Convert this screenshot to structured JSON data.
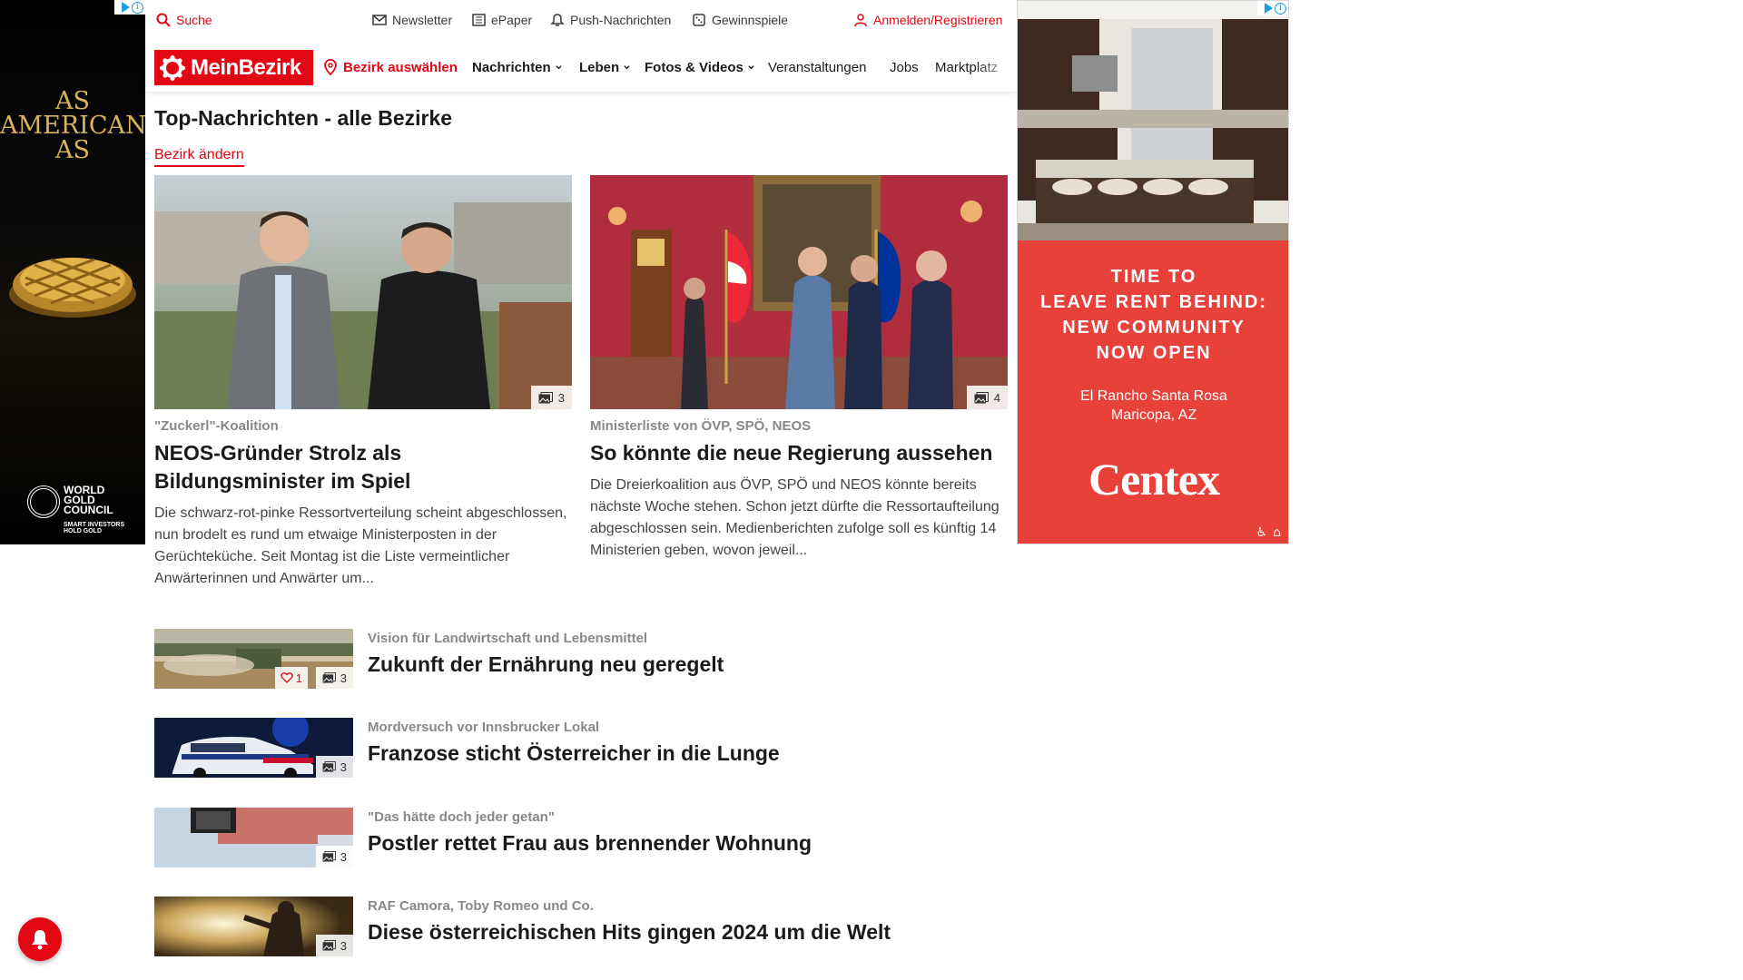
{
  "ad_left": {
    "headline": "AS AMERICAN AS",
    "brand_line1": "WORLD",
    "brand_line2": "GOLD",
    "brand_line3": "COUNCIL",
    "tagline1": "SMART INVESTORS",
    "tagline2": "HOLD GOLD",
    "icons": [
      "adchoices-icon",
      "info-icon"
    ]
  },
  "utility": {
    "search": "Suche",
    "newsletter": "Newsletter",
    "epaper": "ePaper",
    "push": "Push-Nachrichten",
    "gewinnspiele": "Gewinnspiele",
    "login": "Anmelden/Registrieren"
  },
  "nav": {
    "logo": "MeinBezirk",
    "district": "Bezirk auswählen",
    "items": [
      "Nachrichten",
      "Leben",
      "Fotos & Videos",
      "Veranstaltungen",
      "Jobs",
      "Marktplatz"
    ]
  },
  "section": {
    "title": "Top-Nachrichten - alle Bezirke",
    "change_link": "Bezirk ändern"
  },
  "top_stories": [
    {
      "kicker": "\"Zuckerl\"-Koalition",
      "headline": "NEOS-Gründer Strolz als Bildungsminister im Spiel",
      "teaser": "Die schwarz-rot-pinke Ressortverteilung scheint abgeschlossen, nun brodelt es rund um etwaige Ministerposten in der Gerüchteküche. Seit Montag ist die Liste vermeintlicher Anwärterinnen und Anwärter um...",
      "photo_count": "3"
    },
    {
      "kicker": "Ministerliste von ÖVP, SPÖ, NEOS",
      "headline": "So könnte die neue Regierung aussehen",
      "teaser": "Die Dreierkoalition aus ÖVP, SPÖ und NEOS könnte bereits nächste Woche stehen. Schon jetzt dürfte die Ressortaufteilung abgeschlossen sein. Medienberichten zufolge soll es künftig 14 Ministerien geben, wovon jeweil...",
      "photo_count": "4"
    }
  ],
  "list_stories": [
    {
      "kicker": "Vision für Landwirtschaft und Lebensmittel",
      "headline": "Zukunft der Ernährung neu geregelt",
      "photo_count": "3",
      "likes": "1"
    },
    {
      "kicker": "Mordversuch vor Innsbrucker Lokal",
      "headline": "Franzose sticht Österreicher in die Lunge",
      "photo_count": "3"
    },
    {
      "kicker": "\"Das hätte doch jeder getan\"",
      "headline": "Postler rettet Frau aus brennender Wohnung",
      "photo_count": "3"
    },
    {
      "kicker": "RAF Camora, Toby Romeo und Co.",
      "headline": "Diese österreichischen Hits gingen 2024 um die Welt",
      "photo_count": "3"
    }
  ],
  "ad_right": {
    "copy_line1": "TIME TO",
    "copy_line2": "LEAVE RENT BEHIND:",
    "copy_line3": "NEW COMMUNITY",
    "copy_line4": "NOW OPEN",
    "location_line1": "El Rancho Santa Rosa",
    "location_line2": "Maricopa, AZ",
    "brand": "Centex"
  },
  "colors": {
    "brand_red": "#e30613",
    "ad_red": "#e8413a",
    "gold": "#d9b25a"
  }
}
